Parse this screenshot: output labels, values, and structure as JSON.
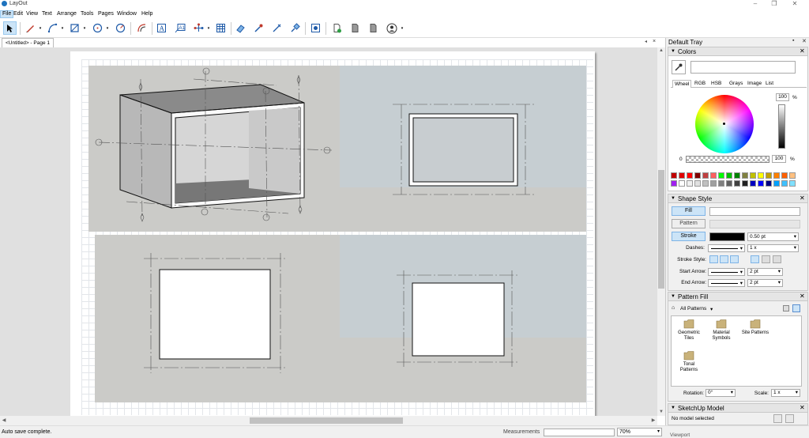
{
  "app": {
    "title": "LayOut",
    "window_buttons": [
      "–",
      "❐",
      "✕"
    ]
  },
  "menu": [
    "File",
    "Edit",
    "View",
    "Text",
    "Arrange",
    "Tools",
    "Pages",
    "Window",
    "Help"
  ],
  "doc_tab": {
    "label": "<Untitled> - Page 1",
    "close": "×",
    "arrow": "◂"
  },
  "tray": {
    "title": "Default Tray",
    "pin": "▪",
    "close": "✕",
    "colors": {
      "header": "Colors",
      "tabs": [
        "Wheel",
        "RGB",
        "HSB",
        "Grays",
        "Image",
        "List"
      ],
      "brightness": "100",
      "percent": "%",
      "opacity": "100",
      "opacity_min": "0",
      "swatches": [
        "#c00000",
        "#e00000",
        "#ff0000",
        "#800000",
        "#c04040",
        "#ff6060",
        "#00ff00",
        "#00c000",
        "#008000",
        "#808040",
        "#c0c000",
        "#ffff00",
        "#c0a000",
        "#ff8000",
        "#ff6000",
        "#ffc080",
        "#a020f0",
        "#ffffff",
        "#f0f0f0",
        "#e0e0e0",
        "#c0c0c0",
        "#a0a0a0",
        "#808080",
        "#606060",
        "#404040",
        "#202020",
        "#0000c0",
        "#0000ff",
        "#000080",
        "#00a0ff",
        "#40c0ff",
        "#80e0ff"
      ]
    },
    "shape_style": {
      "header": "Shape Style",
      "fill": "Fill",
      "pattern": "Pattern",
      "stroke": "Stroke",
      "stroke_width": "0.50 pt",
      "dashes": "Dashes:",
      "dash_scale": "1 x",
      "stroke_style": "Stroke Style:",
      "start_arrow": "Start Arrow:",
      "start_size": "2 pt",
      "end_arrow": "End Arrow:",
      "end_size": "2 pt"
    },
    "pattern_fill": {
      "header": "Pattern Fill",
      "filter": "All Patterns",
      "items": [
        "Geometric Tiles",
        "Material Symbols",
        "Site Patterns",
        "Tonal Patterns"
      ],
      "rotation_label": "Rotation:",
      "rotation": "0°",
      "scale_label": "Scale:",
      "scale": "1 x"
    },
    "sketchup_model": {
      "header": "SketchUp Model",
      "status": "No model selected",
      "viewport": "Viewport"
    }
  },
  "status": {
    "text": "Auto save complete.",
    "measurements_label": "Measurements",
    "zoom": "70%"
  }
}
